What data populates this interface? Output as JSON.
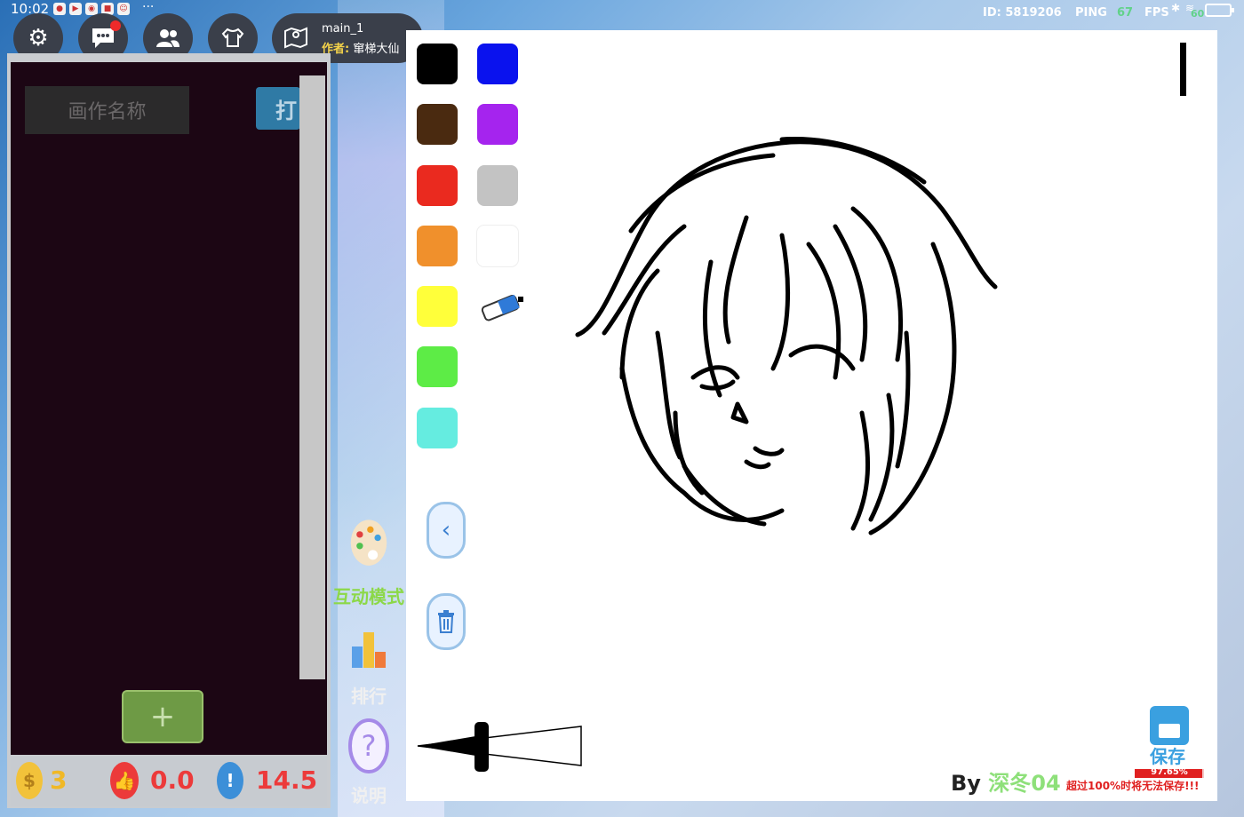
{
  "status": {
    "time": "10:02",
    "overflow": "···",
    "id_text": "ID: 5819206",
    "ping_label": "PING",
    "ping_value": "67",
    "fps_label": "FPS",
    "fps_value": "60"
  },
  "toolbar": {
    "map_name": "main_1",
    "author_label": "作者:",
    "author_name": "窜梯大仙"
  },
  "left_panel": {
    "name_placeholder": "画作名称",
    "open_label": "打",
    "add_label": "+"
  },
  "stats": {
    "coins": "3",
    "likes": "0.0",
    "reports": "14.5"
  },
  "tools": {
    "interactive_label": "互动模式",
    "ranking_label": "排行",
    "help_label": "说明"
  },
  "palette": {
    "colors": [
      "#000000",
      "#0a12ee",
      "#4a2a10",
      "#a524ee",
      "#ea2a1f",
      "#c3c3c3",
      "#f0902c",
      "#ffffff",
      "#ffff3a",
      "#5dec46",
      "#65ece0"
    ]
  },
  "footer": {
    "by_prefix": "By",
    "by_name": "深冬04",
    "save_label": "保存",
    "progress_text": "97.65%",
    "progress_fraction": 0.9765,
    "warning": "超过100%时将无法保存!!!"
  }
}
